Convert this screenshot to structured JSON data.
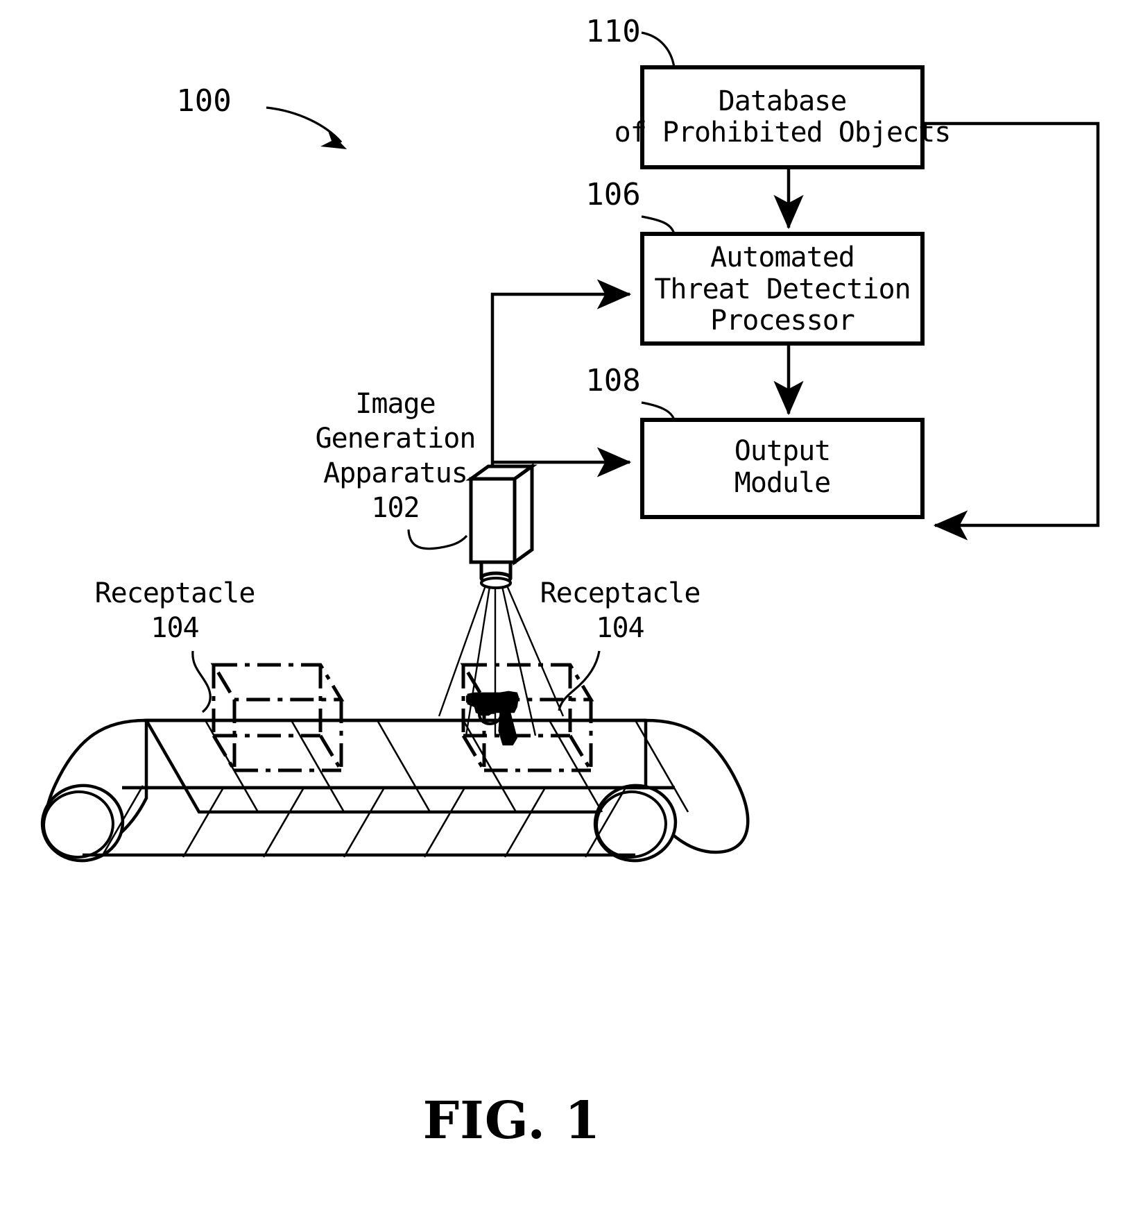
{
  "figure": {
    "caption": "FIG. 1",
    "system_ref": "100"
  },
  "blocks": [
    {
      "id": "database",
      "ref": "110",
      "lines": [
        "Database",
        "of Prohibited Objects"
      ]
    },
    {
      "id": "processor",
      "ref": "106",
      "lines": [
        "Automated",
        "Threat Detection",
        "Processor"
      ]
    },
    {
      "id": "output",
      "ref": "108",
      "lines": [
        "Output",
        "Module"
      ]
    }
  ],
  "callouts": [
    {
      "id": "image-generation-apparatus",
      "lines": [
        "Image",
        "Generation",
        "Apparatus",
        "102"
      ],
      "ref": "102"
    },
    {
      "id": "receptacle-left",
      "lines": [
        "Receptacle",
        "104"
      ],
      "ref": "104"
    },
    {
      "id": "receptacle-right",
      "lines": [
        "Receptacle",
        "104"
      ],
      "ref": "104"
    }
  ],
  "icons": {
    "camera": "scanner-camera-icon",
    "conveyor": "conveyor-belt-icon",
    "receptacle": "receptacle-box-icon",
    "threat_object": "handgun-icon",
    "arrow": "arrow-icon"
  },
  "colors": {
    "stroke": "#000000",
    "background": "#ffffff"
  }
}
